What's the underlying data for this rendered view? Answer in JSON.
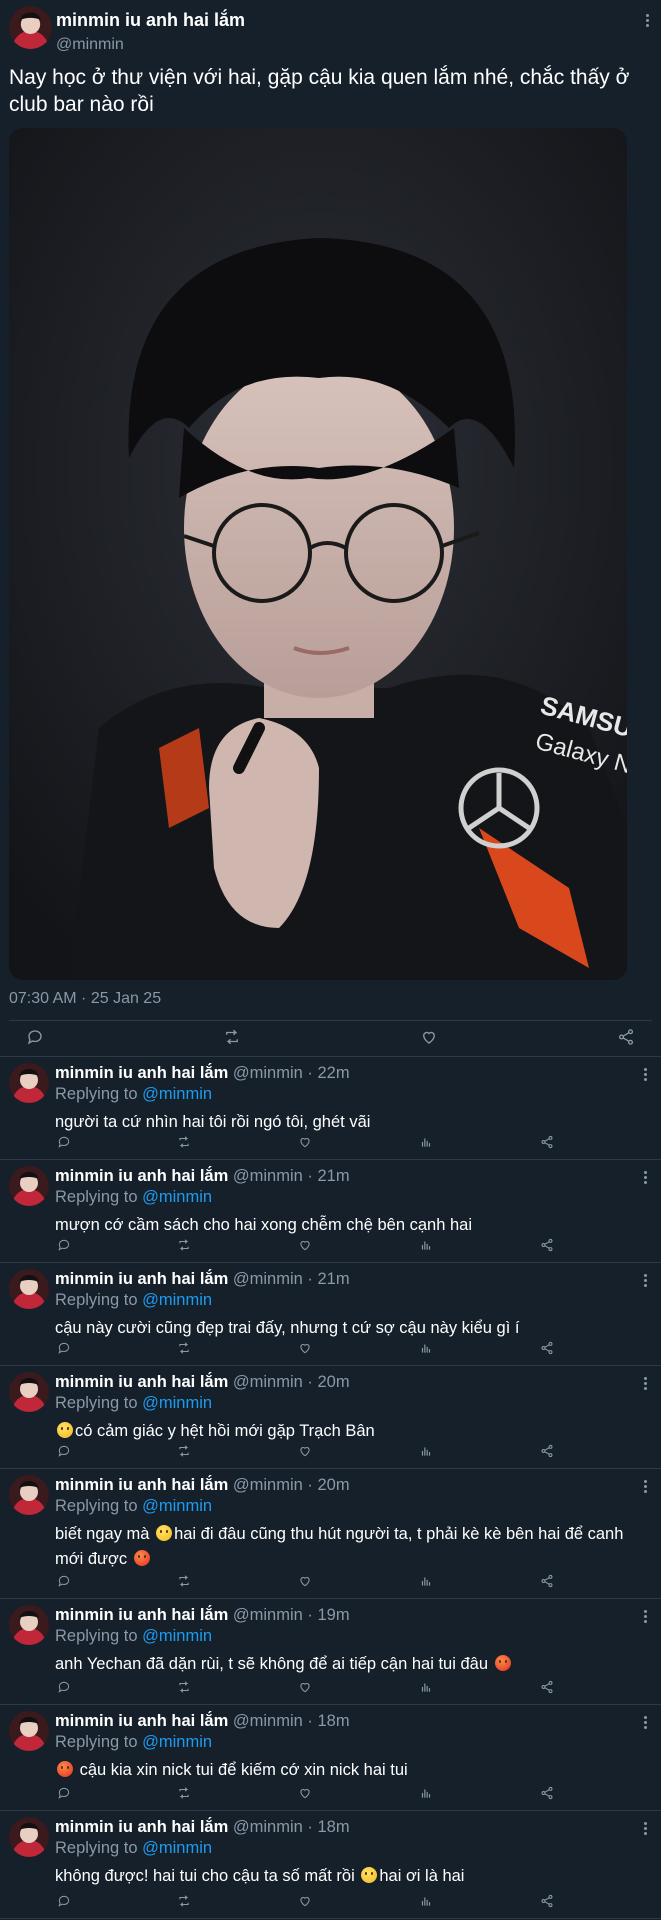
{
  "main_tweet": {
    "name": "minmin iu anh hai lắm",
    "handle": "@minmin",
    "text": "Nay học ở thư viện với hai, gặp cậu kia quen lắm nhé, chắc thấy ở club bar nào rồi",
    "photo_text": [
      "SAMSUNG",
      "Galaxy Neo"
    ],
    "timestamp": "07:30 AM · 25 Jan 25",
    "actions": [
      "reply-icon",
      "retweet-icon",
      "like-icon",
      "share-icon"
    ]
  },
  "replies": [
    {
      "name": "minmin iu anh hai lắm",
      "meta": "@minmin · 22m",
      "replying_prefix": "Replying to ",
      "mention": "@minmin",
      "text_before": "người ta cứ nhìn hai tôi rồi ngó tôi, ghét vãi",
      "emoji1": "",
      "text_mid": "",
      "emoji2": "",
      "text_after": ""
    },
    {
      "name": "minmin iu anh hai lắm",
      "meta": "@minmin · 21m",
      "replying_prefix": "Replying to ",
      "mention": "@minmin",
      "text_before": "mượn cớ cầm sách cho hai xong chễm chệ bên cạnh hai",
      "emoji1": "",
      "text_mid": "",
      "emoji2": "",
      "text_after": ""
    },
    {
      "name": "minmin iu anh hai lắm",
      "meta": "@minmin · 21m",
      "replying_prefix": "Replying to ",
      "mention": "@minmin",
      "text_before": "cậu này cười cũng đẹp trai đấy, nhưng t cứ sợ cậu này kiểu gì í",
      "emoji1": "",
      "text_mid": "",
      "emoji2": "",
      "text_after": ""
    },
    {
      "name": "minmin iu anh hai lắm",
      "meta": "@minmin · 20m",
      "replying_prefix": "Replying to ",
      "mention": "@minmin",
      "text_before": "",
      "emoji1": "slightly-frowning-face",
      "text_mid": "có cảm giác y hệt hồi mới gặp Trạch Bân",
      "emoji2": "",
      "text_after": ""
    },
    {
      "name": "minmin iu anh hai lắm",
      "meta": "@minmin · 20m",
      "replying_prefix": "Replying to ",
      "mention": "@minmin",
      "text_before": "biết ngay mà ",
      "emoji1": "face-with-steam",
      "text_mid": "hai đi đâu cũng thu hút người ta, t phải kè kè bên hai để canh mới được ",
      "emoji2": "angry-face",
      "text_after": ""
    },
    {
      "name": "minmin iu anh hai lắm",
      "meta": "@minmin · 19m",
      "replying_prefix": "Replying to ",
      "mention": "@minmin",
      "text_before": "anh Yechan đã dặn rùi, t sẽ không để ai tiếp cận hai tui đâu ",
      "emoji1": "angry-face",
      "text_mid": "",
      "emoji2": "",
      "text_after": ""
    },
    {
      "name": "minmin iu anh hai lắm",
      "meta": "@minmin · 18m",
      "replying_prefix": "Replying to ",
      "mention": "@minmin",
      "text_before": "",
      "emoji1": "angry-face",
      "text_mid": " cậu kia xin nick tui để kiếm cớ xin nick hai tui",
      "emoji2": "",
      "text_after": ""
    },
    {
      "name": "minmin iu anh hai lắm",
      "meta": "@minmin · 18m",
      "replying_prefix": "Replying to ",
      "mention": "@minmin",
      "text_before": "không được! hai tui cho cậu ta số mất rồi ",
      "emoji1": "tired-face",
      "text_mid": "hai ơi là hai",
      "emoji2": "",
      "text_after": ""
    }
  ],
  "colors": {
    "background": "#15202b",
    "divider": "#2f3943",
    "secondary_text": "#8b98a5",
    "mention": "#1d9bf0"
  }
}
